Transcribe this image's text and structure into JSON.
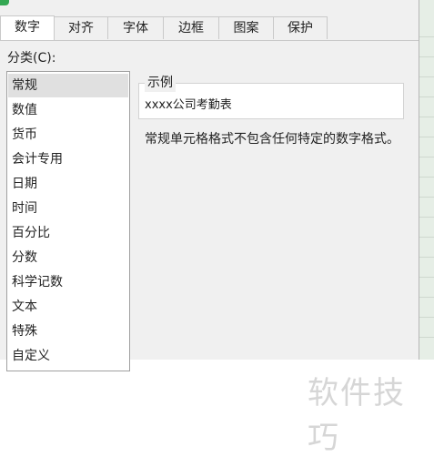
{
  "tabs": [
    {
      "label": "数字"
    },
    {
      "label": "对齐"
    },
    {
      "label": "字体"
    },
    {
      "label": "边框"
    },
    {
      "label": "图案"
    },
    {
      "label": "保护"
    }
  ],
  "category": {
    "label": "分类(C):",
    "items": [
      "常规",
      "数值",
      "货币",
      "会计专用",
      "日期",
      "时间",
      "百分比",
      "分数",
      "科学记数",
      "文本",
      "特殊",
      "自定义"
    ],
    "selected": "常规"
  },
  "sample": {
    "title": "示例",
    "value": "xxxx公司考勤表"
  },
  "description": "常规单元格格式不包含任何特定的数字格式。",
  "watermark": "软件技巧",
  "colors": {
    "accent": "#34a853",
    "dialog_bg": "#f0f0f0",
    "selected_bg": "#e0e0e0"
  }
}
